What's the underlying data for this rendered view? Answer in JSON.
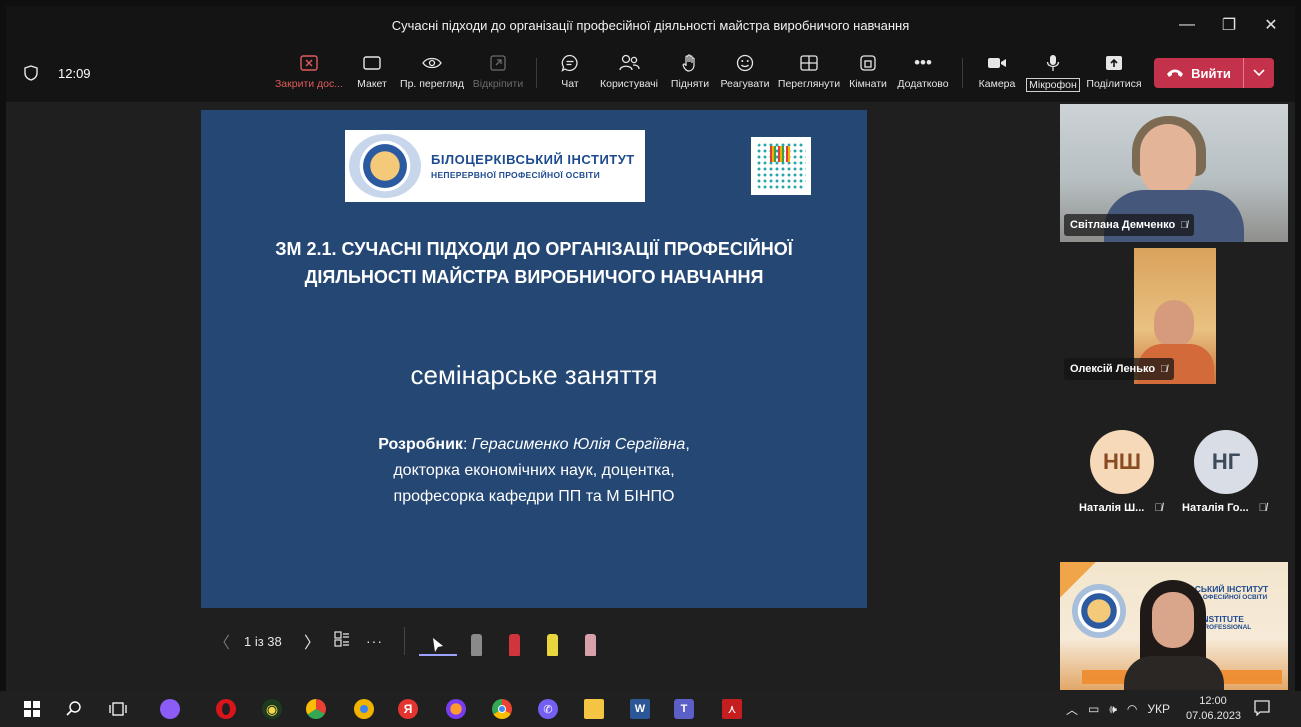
{
  "window": {
    "title": "Сучасні підходи до організації професійної діяльності майстра виробничого навчання",
    "controls": [
      "—",
      "❐",
      "✕"
    ]
  },
  "toolbar": {
    "shield_icon": "shield-icon",
    "time": "12:09",
    "buttons": {
      "stop_sharing": "Закрити дос...",
      "layout": "Макет",
      "view": "Пр. перегляд",
      "pop_out": "Відкріпити",
      "chat": "Чат",
      "people": "Користувачі",
      "raise": "Підняти",
      "react": "Реагувати",
      "view_grid": "Переглянути",
      "rooms": "Кімнати",
      "more": "Додатково",
      "camera": "Камера",
      "mic": "Мікрофон",
      "share": "Поділитися"
    },
    "leave_label": "Вийти",
    "colors": {
      "leave": "#c4314b",
      "stop_sharing": "#e05b5b"
    }
  },
  "slide": {
    "logo_line1": "БІЛОЦЕРКІВСЬКИЙ ІНСТИТУТ",
    "logo_line2": "НЕПЕРЕРВНОЇ ПРОФЕСІЙНОЇ ОСВІТИ",
    "title_line1": "ЗМ 2.1. СУЧАСНІ ПІДХОДИ ДО ОРГАНІЗАЦІЇ ПРОФЕСІЙНОЇ",
    "title_line2": "ДІЯЛЬНОСТІ МАЙСТРА ВИРОБНИЧОГО НАВЧАННЯ",
    "subtitle": "семінарське заняття",
    "author_label": "Розробник",
    "author_colon": ": ",
    "author_name": "Герасименко Юлія Сергіївна",
    "author_comma": ",",
    "author_line2": "докторка економічних наук, доцентка,",
    "author_line3": "професорка кафедри ПП та М БІНПО",
    "background": "#244774"
  },
  "slide_controls": {
    "prev": "〈",
    "counter": "1 із 38",
    "next": "〉",
    "more": "···"
  },
  "participants": {
    "p1_name": "Світлана Демченко",
    "p2_name": "Олексій Ленько",
    "p3_initials": "НШ",
    "p3_name": "Наталія Ш...",
    "p4_initials": "НГ",
    "p4_name": "Наталія Го...",
    "self_t1": "БІЛ   СЬКИЙ ІНСТИТУТ",
    "self_t2": "НЕ           ОФЕСІЙНОЇ ОСВІТИ",
    "self_t3": "INSTITUTE",
    "self_t4": "PROFESSIONAL",
    "colors": {
      "nsh": "#f5d9b8",
      "ng": "#d9dee6"
    }
  },
  "taskbar": {
    "lang": "УКР",
    "time": "12:00",
    "date": "07.06.2023"
  }
}
